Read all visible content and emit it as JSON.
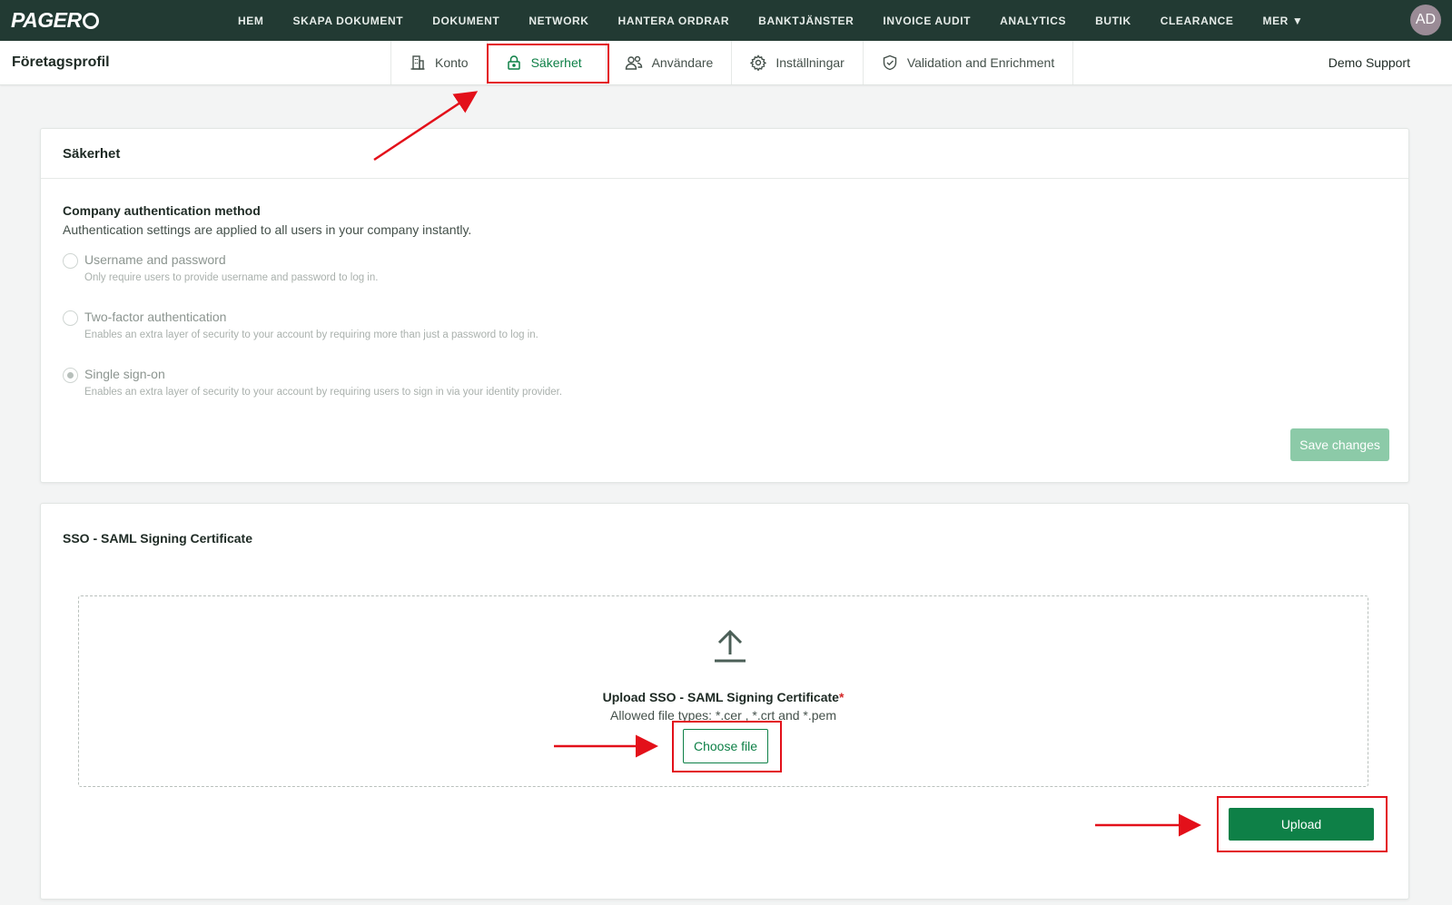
{
  "brand": {
    "logo": "PAGER",
    "accent": "#0e8047",
    "nav_bg": "#223a33"
  },
  "topnav": {
    "items": [
      "HEM",
      "SKAPA DOKUMENT",
      "DOKUMENT",
      "NETWORK",
      "HANTERA ORDRAR",
      "BANKTJÄNSTER",
      "INVOICE AUDIT",
      "ANALYTICS",
      "BUTIK",
      "CLEARANCE",
      "MER ▼"
    ],
    "avatar": "AD"
  },
  "subnav": {
    "title": "Företagsprofil",
    "tabs": [
      {
        "label": "Konto",
        "icon": "building-icon"
      },
      {
        "label": "Säkerhet",
        "icon": "lock-icon",
        "active": true
      },
      {
        "label": "Användare",
        "icon": "users-icon"
      },
      {
        "label": "Inställningar",
        "icon": "gear-icon"
      },
      {
        "label": "Validation and Enrichment",
        "icon": "shield-check-icon"
      }
    ],
    "user": "Demo Support"
  },
  "security": {
    "heading": "Säkerhet",
    "section_title": "Company authentication method",
    "section_sub": "Authentication settings are applied to all users in your company instantly.",
    "options": [
      {
        "label": "Username and password",
        "desc": "Only require users to provide username and password to log in.",
        "checked": false
      },
      {
        "label": "Two-factor authentication",
        "desc": "Enables an extra layer of security to your account by requiring more than just a password to log in.",
        "checked": false
      },
      {
        "label": "Single sign-on",
        "desc": "Enables an extra layer of security to your account by requiring users to sign in via your identity provider.",
        "checked": true
      }
    ],
    "save_label": "Save changes"
  },
  "sso": {
    "heading": "SSO - SAML Signing Certificate",
    "drop_title": "Upload SSO - SAML Signing Certificate",
    "required_mark": "*",
    "allowed": "Allowed file types: *.cer , *.crt and *.pem",
    "choose_label": "Choose file",
    "upload_label": "Upload"
  }
}
